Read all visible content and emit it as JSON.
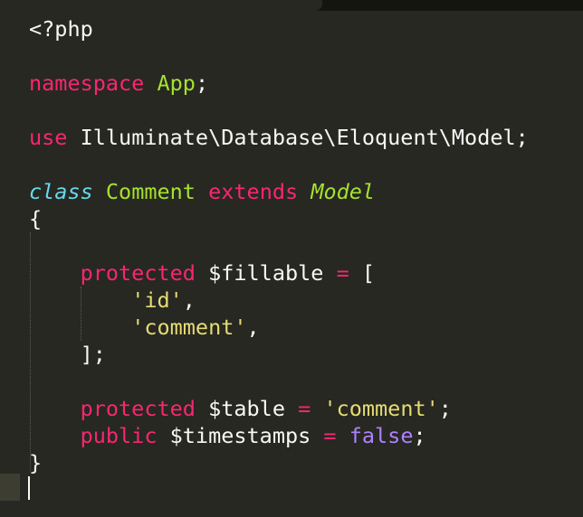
{
  "editor": {
    "lines": [
      [
        {
          "t": "<?php",
          "c": "plain"
        }
      ],
      [],
      [
        {
          "t": "namespace",
          "c": "kw"
        },
        {
          "t": " ",
          "c": "plain"
        },
        {
          "t": "App",
          "c": "green"
        },
        {
          "t": ";",
          "c": "plain"
        }
      ],
      [],
      [
        {
          "t": "use",
          "c": "kw"
        },
        {
          "t": " Illuminate\\Database\\Eloquent\\Model;",
          "c": "plain"
        }
      ],
      [],
      [
        {
          "t": "class",
          "c": "storage"
        },
        {
          "t": " ",
          "c": "plain"
        },
        {
          "t": "Comment",
          "c": "green"
        },
        {
          "t": " ",
          "c": "plain"
        },
        {
          "t": "extends",
          "c": "kw"
        },
        {
          "t": " ",
          "c": "plain"
        },
        {
          "t": "Model",
          "c": "green-it"
        }
      ],
      [
        {
          "t": "{",
          "c": "plain"
        }
      ],
      [],
      [
        {
          "t": "    ",
          "c": "plain"
        },
        {
          "t": "protected",
          "c": "kw"
        },
        {
          "t": " $fillable ",
          "c": "plain"
        },
        {
          "t": "=",
          "c": "kw"
        },
        {
          "t": " [",
          "c": "plain"
        }
      ],
      [
        {
          "t": "        ",
          "c": "plain"
        },
        {
          "t": "'id'",
          "c": "str"
        },
        {
          "t": ",",
          "c": "plain"
        }
      ],
      [
        {
          "t": "        ",
          "c": "plain"
        },
        {
          "t": "'comment'",
          "c": "str"
        },
        {
          "t": ",",
          "c": "plain"
        }
      ],
      [
        {
          "t": "    ];",
          "c": "plain"
        }
      ],
      [],
      [
        {
          "t": "    ",
          "c": "plain"
        },
        {
          "t": "protected",
          "c": "kw"
        },
        {
          "t": " $table ",
          "c": "plain"
        },
        {
          "t": "=",
          "c": "kw"
        },
        {
          "t": " ",
          "c": "plain"
        },
        {
          "t": "'comment'",
          "c": "str"
        },
        {
          "t": ";",
          "c": "plain"
        }
      ],
      [
        {
          "t": "    ",
          "c": "plain"
        },
        {
          "t": "public",
          "c": "kw"
        },
        {
          "t": " $timestamps ",
          "c": "plain"
        },
        {
          "t": "=",
          "c": "kw"
        },
        {
          "t": " ",
          "c": "plain"
        },
        {
          "t": "false",
          "c": "const"
        },
        {
          "t": ";",
          "c": "plain"
        }
      ],
      [
        {
          "t": "}",
          "c": "plain"
        }
      ],
      []
    ]
  },
  "colors": {
    "background": "#272822",
    "keyword": "#f92672",
    "entity": "#a6e22e",
    "storage": "#66d9ef",
    "string": "#e6db74",
    "constant": "#ae81ff",
    "text": "#f8f8f2"
  }
}
